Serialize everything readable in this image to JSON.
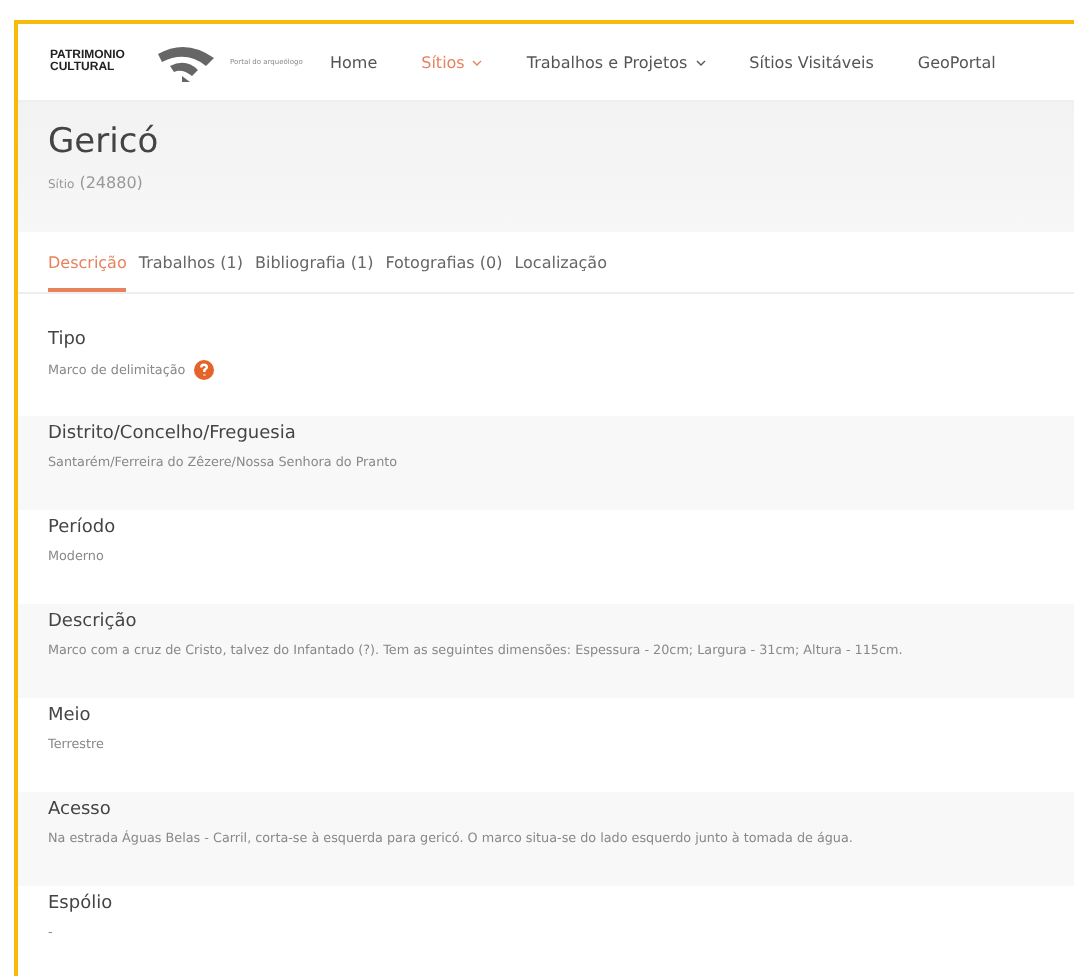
{
  "logo": {
    "title": "PATRIMONIO CULTURAL",
    "subtitle": "Portal do arqueólogo"
  },
  "nav": [
    {
      "label": "Home",
      "selected": false,
      "dropdown": false
    },
    {
      "label": "Sítios",
      "selected": true,
      "dropdown": true
    },
    {
      "label": "Trabalhos e Projetos",
      "selected": false,
      "dropdown": true
    },
    {
      "label": "Sítios Visitáveis",
      "selected": false,
      "dropdown": false
    },
    {
      "label": "GeoPortal",
      "selected": false,
      "dropdown": false
    }
  ],
  "title": "Gericó",
  "subtitle_label": "Sítio",
  "subtitle_id": "(24880)",
  "tabs": [
    {
      "label": "Descrição",
      "selected": true
    },
    {
      "label": "Trabalhos (1)",
      "selected": false
    },
    {
      "label": "Bibliografia (1)",
      "selected": false
    },
    {
      "label": "Fotografias (0)",
      "selected": false
    },
    {
      "label": "Localização",
      "selected": false
    }
  ],
  "fields": [
    {
      "label": "Tipo",
      "value": "Marco de delimitação",
      "help": true
    },
    {
      "label": "Distrito/Concelho/Freguesia",
      "value": "Santarém/Ferreira do Zêzere/Nossa Senhora do Pranto",
      "help": false
    },
    {
      "label": "Período",
      "value": "Moderno",
      "help": false
    },
    {
      "label": "Descrição",
      "value": "Marco com a cruz de Cristo, talvez do Infantado (?). Tem as seguintes dimensões: Espessura - 20cm; Largura - 31cm; Altura - 115cm.",
      "help": false
    },
    {
      "label": "Meio",
      "value": "Terrestre",
      "help": false
    },
    {
      "label": "Acesso",
      "value": "Na estrada Águas Belas - Carril, corta-se à esquerda para gericó. O marco situa-se do lado esquerdo junto à tomada de água.",
      "help": false
    },
    {
      "label": "Espólio",
      "value": "-",
      "help": false
    }
  ]
}
